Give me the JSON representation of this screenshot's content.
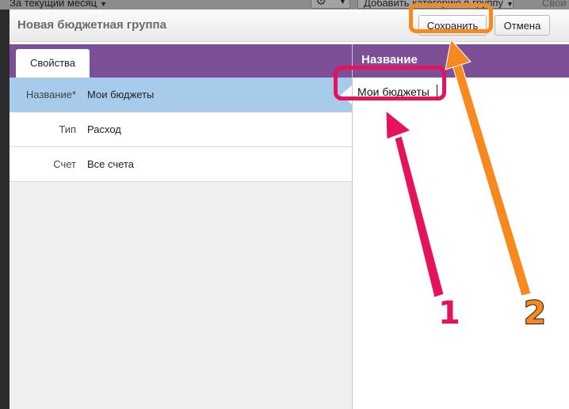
{
  "background": {
    "period_label": "За текущий месяц",
    "add_category_label": "Добавить категорию в группу",
    "right_cut_label": "Свой"
  },
  "dialog": {
    "title": "Новая бюджетная группа",
    "save_label": "Сохранить",
    "cancel_label": "Отмена"
  },
  "tabs": [
    {
      "label": "Свойства",
      "active": true
    }
  ],
  "properties": [
    {
      "label": "Название*",
      "value": "Мои бюджеты",
      "selected": true
    },
    {
      "label": "Тип",
      "value": "Расход",
      "selected": false
    },
    {
      "label": "Счет",
      "value": "Все счета",
      "selected": false
    }
  ],
  "editor": {
    "header": "Название",
    "value": "Мои бюджеты"
  },
  "annotations": {
    "step1": "1",
    "step2": "2",
    "step1_color": "#e4135b",
    "step2_color": "#f7891f"
  },
  "colors": {
    "accent": "#7d4f96",
    "selected_row": "#a7cceb"
  }
}
